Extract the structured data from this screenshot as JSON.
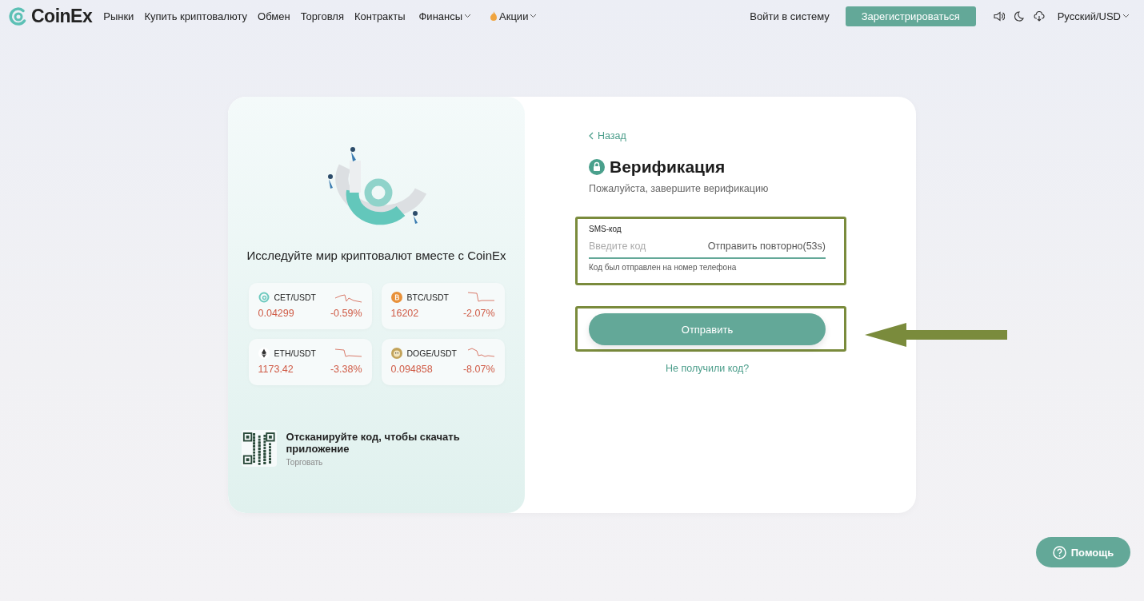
{
  "header": {
    "logo": "CoinEx",
    "nav": [
      {
        "label": "Рынки",
        "kind": "link"
      },
      {
        "label": "Купить криптовалюту",
        "kind": "link"
      },
      {
        "label": "Обмен",
        "kind": "link"
      },
      {
        "label": "Торговля",
        "kind": "link"
      },
      {
        "label": "Контракты",
        "kind": "link"
      },
      {
        "label": "Финансы",
        "kind": "dropdown"
      },
      {
        "label": "Акции",
        "kind": "promo"
      }
    ],
    "login": "Войти в систему",
    "register": "Зарегистрироваться",
    "language": "Русский/USD"
  },
  "promo": {
    "title": "Исследуйте мир криптовалют вместе с CoinEx",
    "tickers": [
      {
        "kind": "cet",
        "pair": "CET/USDT",
        "price": "0.04299",
        "change": "-0.59%"
      },
      {
        "kind": "btc",
        "pair": "BTC/USDT",
        "price": "16202",
        "change": "-2.07%"
      },
      {
        "kind": "eth",
        "pair": "ETH/USDT",
        "price": "1173.42",
        "change": "-3.38%"
      },
      {
        "kind": "doge",
        "pair": "DOGE/USDT",
        "price": "0.094858",
        "change": "-8.07%"
      }
    ],
    "app": {
      "title": "Отсканируйте код, чтобы скачать приложение",
      "subtitle": "Торговать"
    }
  },
  "form": {
    "back": "Назад",
    "title": "Верификация",
    "subtitle": "Пожалуйста, завершите верификацию",
    "field": {
      "label": "SMS-код",
      "placeholder": "Введите код",
      "resend": "Отправить повторно(53s)",
      "hint": "Код был отправлен на номер телефона"
    },
    "submit": "Отправить",
    "no_code": "Не получили код?"
  },
  "help": "Помощь"
}
